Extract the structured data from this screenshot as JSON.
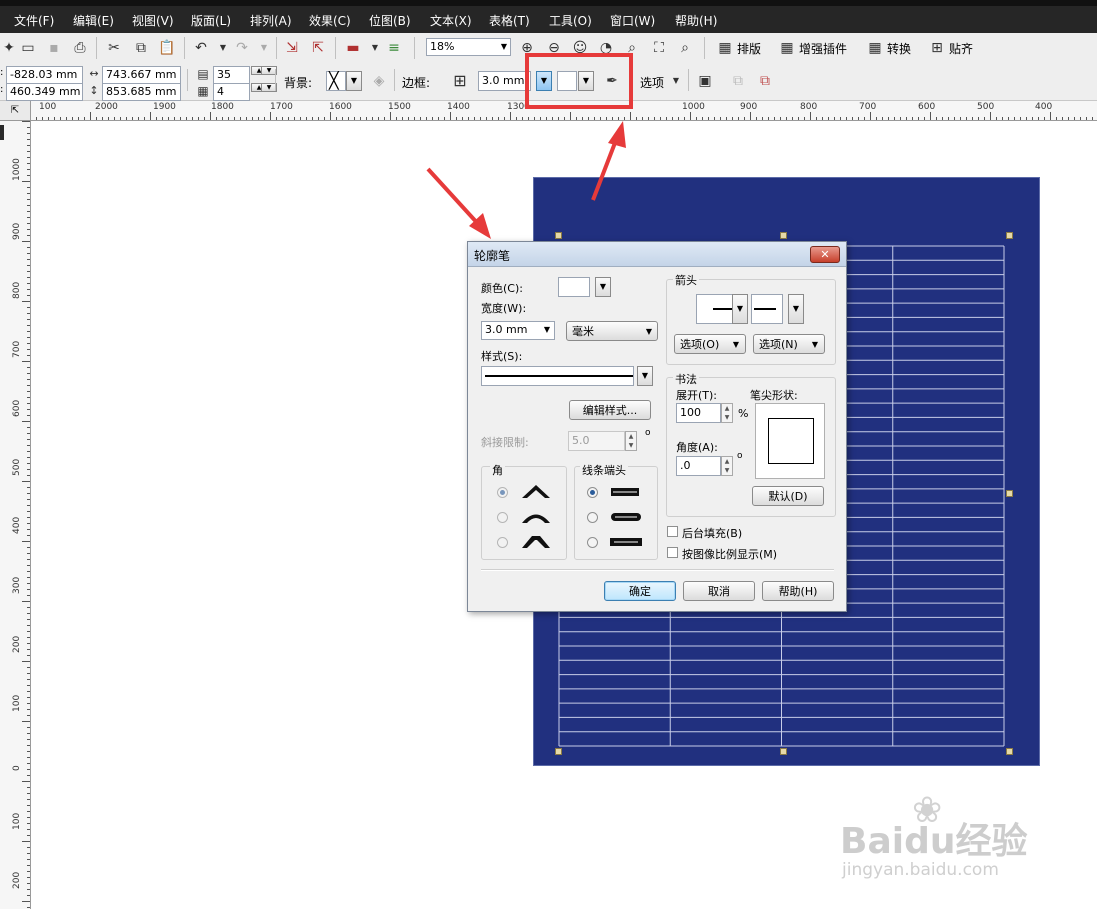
{
  "menubar": {
    "items": [
      "文件(F)",
      "编辑(E)",
      "视图(V)",
      "版面(L)",
      "排列(A)",
      "效果(C)",
      "位图(B)",
      "文本(X)",
      "表格(T)",
      "工具(O)",
      "窗口(W)",
      "帮助(H)"
    ]
  },
  "toolbar": {
    "zoom_value": "18%",
    "buttons": [
      "排版",
      "增强插件",
      "转换",
      "贴齐"
    ]
  },
  "property_bar": {
    "x_value": "-828.03 mm",
    "y_value": "460.349 mm",
    "width_value": "743.667 mm",
    "height_value": "853.685 mm",
    "rows_value": "35",
    "cols_value": "4",
    "background_label": "背景:",
    "border_label": "边框:",
    "border_width": "3.0 mm",
    "options_label": "选项"
  },
  "rulers": {
    "horizontal": [
      "100",
      "2000",
      "1900",
      "1800",
      "1700",
      "1600",
      "1500",
      "1400",
      "1300",
      "1000",
      "900",
      "800",
      "700",
      "600",
      "500",
      "400"
    ],
    "vertical": [
      "1000",
      "900",
      "800",
      "700",
      "600",
      "500",
      "400",
      "300",
      "200",
      "100",
      "0",
      "100",
      "200"
    ]
  },
  "dialog": {
    "title": "轮廓笔",
    "color_label": "颜色(C):",
    "width_label": "宽度(W):",
    "width_value": "3.0 mm",
    "unit_value": "毫米",
    "style_label": "样式(S):",
    "edit_style_button": "编辑样式...",
    "miter_label": "斜接限制:",
    "miter_value": "5.0",
    "corner_label": "角",
    "linecap_label": "线条端头",
    "arrow_label": "箭头",
    "arrow_option1": "选项(O)",
    "arrow_option2": "选项(N)",
    "calligraphy_label": "书法",
    "stretch_label": "展开(T):",
    "stretch_value": "100",
    "stretch_unit": "%",
    "angle_label": "角度(A):",
    "angle_value": ".0",
    "angle_unit": "o",
    "miter_unit": "o",
    "nib_shape_label": "笔尖形状:",
    "default_button": "默认(D)",
    "behind_fill_label": "后台填充(B)",
    "scale_with_image_label": "按图像比例显示(M)",
    "ok_button": "确定",
    "cancel_button": "取消",
    "help_button": "帮助(H)"
  },
  "colors": {
    "highlight": "#e63a3a",
    "document_fill": "#21307f",
    "grid_lines": "#c8cde8"
  },
  "watermark": {
    "brand": "Baidu经验",
    "url": "jingyan.baidu.com"
  }
}
